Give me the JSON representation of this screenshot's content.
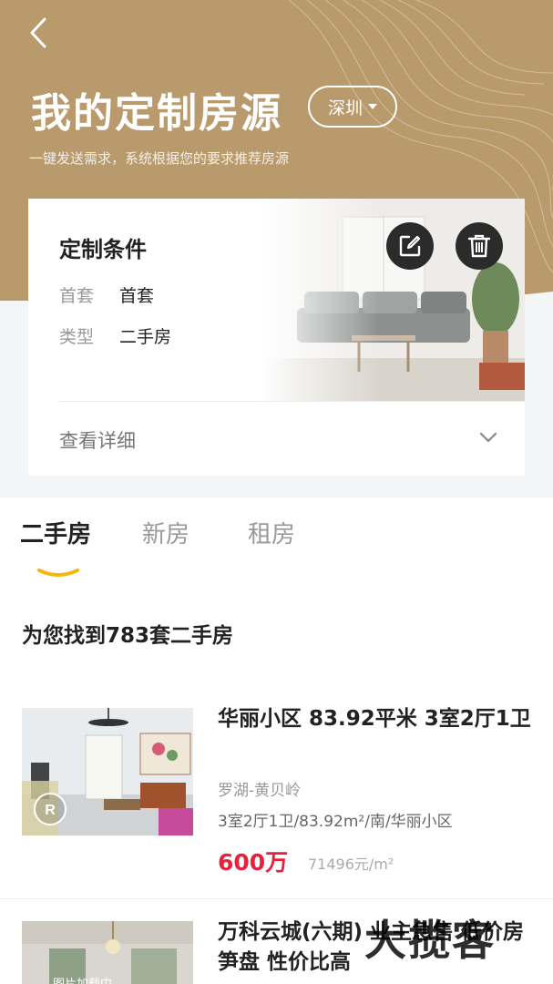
{
  "header": {
    "title": "我的定制房源",
    "city": "深圳",
    "subtitle": "一键发送需求，系统根据您的要求推荐房源"
  },
  "condition_card": {
    "title": "定制条件",
    "rows": [
      {
        "key": "首套",
        "value": "首套"
      },
      {
        "key": "类型",
        "value": "二手房"
      }
    ],
    "detail_label": "查看详细"
  },
  "tabs": [
    {
      "label": "二手房",
      "active": true
    },
    {
      "label": "新房",
      "active": false
    },
    {
      "label": "租房",
      "active": false
    }
  ],
  "result_count_text": "为您找到783套二手房",
  "listings": [
    {
      "title": "华丽小区 83.92平米 3室2厅1卫",
      "area": "罗湖-黄贝岭",
      "desc": "3室2厅1卫/83.92m²/南/华丽小区",
      "price": "600万",
      "unit_price": "71496元/m²"
    },
    {
      "title": "万科云城(六期) 业主急售 低价房笋盘 性价比高",
      "thumb_badge": "图片加载中"
    }
  ],
  "watermark": "大揽客",
  "colors": {
    "hero": "#b89a6c",
    "price": "#e6223d",
    "tab_underline": "#f2b807"
  },
  "icons": [
    "back-arrow-icon",
    "caret-down-icon",
    "edit-icon",
    "trash-icon",
    "chevron-down-icon",
    "vr-icon"
  ]
}
